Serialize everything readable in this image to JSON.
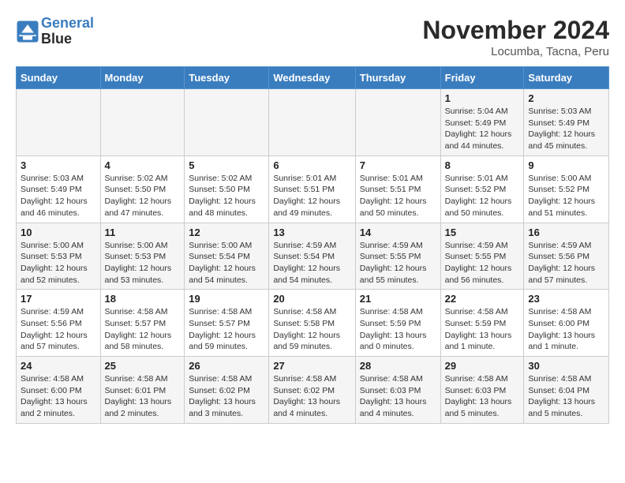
{
  "logo": {
    "line1": "General",
    "line2": "Blue"
  },
  "title": "November 2024",
  "location": "Locumba, Tacna, Peru",
  "weekdays": [
    "Sunday",
    "Monday",
    "Tuesday",
    "Wednesday",
    "Thursday",
    "Friday",
    "Saturday"
  ],
  "weeks": [
    [
      {
        "day": "",
        "info": ""
      },
      {
        "day": "",
        "info": ""
      },
      {
        "day": "",
        "info": ""
      },
      {
        "day": "",
        "info": ""
      },
      {
        "day": "",
        "info": ""
      },
      {
        "day": "1",
        "info": "Sunrise: 5:04 AM\nSunset: 5:49 PM\nDaylight: 12 hours\nand 44 minutes."
      },
      {
        "day": "2",
        "info": "Sunrise: 5:03 AM\nSunset: 5:49 PM\nDaylight: 12 hours\nand 45 minutes."
      }
    ],
    [
      {
        "day": "3",
        "info": "Sunrise: 5:03 AM\nSunset: 5:49 PM\nDaylight: 12 hours\nand 46 minutes."
      },
      {
        "day": "4",
        "info": "Sunrise: 5:02 AM\nSunset: 5:50 PM\nDaylight: 12 hours\nand 47 minutes."
      },
      {
        "day": "5",
        "info": "Sunrise: 5:02 AM\nSunset: 5:50 PM\nDaylight: 12 hours\nand 48 minutes."
      },
      {
        "day": "6",
        "info": "Sunrise: 5:01 AM\nSunset: 5:51 PM\nDaylight: 12 hours\nand 49 minutes."
      },
      {
        "day": "7",
        "info": "Sunrise: 5:01 AM\nSunset: 5:51 PM\nDaylight: 12 hours\nand 50 minutes."
      },
      {
        "day": "8",
        "info": "Sunrise: 5:01 AM\nSunset: 5:52 PM\nDaylight: 12 hours\nand 50 minutes."
      },
      {
        "day": "9",
        "info": "Sunrise: 5:00 AM\nSunset: 5:52 PM\nDaylight: 12 hours\nand 51 minutes."
      }
    ],
    [
      {
        "day": "10",
        "info": "Sunrise: 5:00 AM\nSunset: 5:53 PM\nDaylight: 12 hours\nand 52 minutes."
      },
      {
        "day": "11",
        "info": "Sunrise: 5:00 AM\nSunset: 5:53 PM\nDaylight: 12 hours\nand 53 minutes."
      },
      {
        "day": "12",
        "info": "Sunrise: 5:00 AM\nSunset: 5:54 PM\nDaylight: 12 hours\nand 54 minutes."
      },
      {
        "day": "13",
        "info": "Sunrise: 4:59 AM\nSunset: 5:54 PM\nDaylight: 12 hours\nand 54 minutes."
      },
      {
        "day": "14",
        "info": "Sunrise: 4:59 AM\nSunset: 5:55 PM\nDaylight: 12 hours\nand 55 minutes."
      },
      {
        "day": "15",
        "info": "Sunrise: 4:59 AM\nSunset: 5:55 PM\nDaylight: 12 hours\nand 56 minutes."
      },
      {
        "day": "16",
        "info": "Sunrise: 4:59 AM\nSunset: 5:56 PM\nDaylight: 12 hours\nand 57 minutes."
      }
    ],
    [
      {
        "day": "17",
        "info": "Sunrise: 4:59 AM\nSunset: 5:56 PM\nDaylight: 12 hours\nand 57 minutes."
      },
      {
        "day": "18",
        "info": "Sunrise: 4:58 AM\nSunset: 5:57 PM\nDaylight: 12 hours\nand 58 minutes."
      },
      {
        "day": "19",
        "info": "Sunrise: 4:58 AM\nSunset: 5:57 PM\nDaylight: 12 hours\nand 59 minutes."
      },
      {
        "day": "20",
        "info": "Sunrise: 4:58 AM\nSunset: 5:58 PM\nDaylight: 12 hours\nand 59 minutes."
      },
      {
        "day": "21",
        "info": "Sunrise: 4:58 AM\nSunset: 5:59 PM\nDaylight: 13 hours\nand 0 minutes."
      },
      {
        "day": "22",
        "info": "Sunrise: 4:58 AM\nSunset: 5:59 PM\nDaylight: 13 hours\nand 1 minute."
      },
      {
        "day": "23",
        "info": "Sunrise: 4:58 AM\nSunset: 6:00 PM\nDaylight: 13 hours\nand 1 minute."
      }
    ],
    [
      {
        "day": "24",
        "info": "Sunrise: 4:58 AM\nSunset: 6:00 PM\nDaylight: 13 hours\nand 2 minutes."
      },
      {
        "day": "25",
        "info": "Sunrise: 4:58 AM\nSunset: 6:01 PM\nDaylight: 13 hours\nand 2 minutes."
      },
      {
        "day": "26",
        "info": "Sunrise: 4:58 AM\nSunset: 6:02 PM\nDaylight: 13 hours\nand 3 minutes."
      },
      {
        "day": "27",
        "info": "Sunrise: 4:58 AM\nSunset: 6:02 PM\nDaylight: 13 hours\nand 4 minutes."
      },
      {
        "day": "28",
        "info": "Sunrise: 4:58 AM\nSunset: 6:03 PM\nDaylight: 13 hours\nand 4 minutes."
      },
      {
        "day": "29",
        "info": "Sunrise: 4:58 AM\nSunset: 6:03 PM\nDaylight: 13 hours\nand 5 minutes."
      },
      {
        "day": "30",
        "info": "Sunrise: 4:58 AM\nSunset: 6:04 PM\nDaylight: 13 hours\nand 5 minutes."
      }
    ]
  ]
}
